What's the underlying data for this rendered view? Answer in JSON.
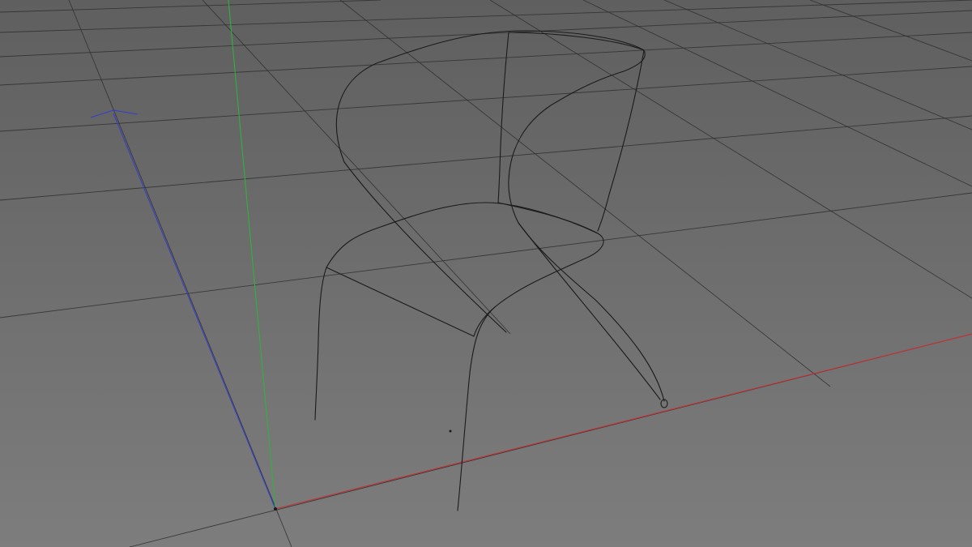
{
  "viewport": {
    "type": "3d-perspective-viewport",
    "background_top": "#5f5f5f",
    "background_bottom": "#7d7d7d",
    "grid_color": "#2f2f2f",
    "grid_visible": true
  },
  "axes": {
    "x_color": "#c83232",
    "y_color": "#2fb23a",
    "z_color": "#3540c8"
  },
  "scene": {
    "object": "chair-wireframe-curves",
    "curve_color": "#1b1b1b"
  }
}
